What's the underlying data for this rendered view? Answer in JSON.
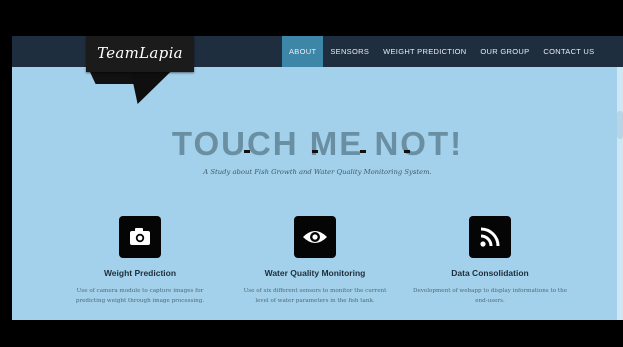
{
  "brand": {
    "logo_text": "TeamLapia"
  },
  "nav": {
    "items": [
      {
        "label": "ABOUT",
        "active": true
      },
      {
        "label": "SENSORS",
        "active": false
      },
      {
        "label": "WEIGHT PREDICTION",
        "active": false
      },
      {
        "label": "OUR GROUP",
        "active": false
      },
      {
        "label": "CONTACT US",
        "active": false
      }
    ]
  },
  "hero": {
    "title": "TOUCH ME NOT!",
    "subtitle": "A Study about Fish Growth and Water Quality Monitoring System."
  },
  "features": [
    {
      "icon": "camera-icon",
      "title": "Weight Prediction",
      "desc_line1": "Use of camera module to capture images for",
      "desc_line2": "predicting weight through image processing."
    },
    {
      "icon": "eye-icon",
      "title": "Water Quality Monitoring",
      "desc_line1": "Use of six different sensors to monitor the current",
      "desc_line2": "level of water parameters in the fish tank."
    },
    {
      "icon": "rss-icon",
      "title": "Data Consolidation",
      "desc_line1": "Development of webapp to display informations to the",
      "desc_line2": "end-users."
    }
  ],
  "colors": {
    "navbar": "#1e2e3e",
    "active_nav": "#3d86a8",
    "page_bg": "#a3d0ea",
    "hero_title": "#6a8fa3"
  }
}
